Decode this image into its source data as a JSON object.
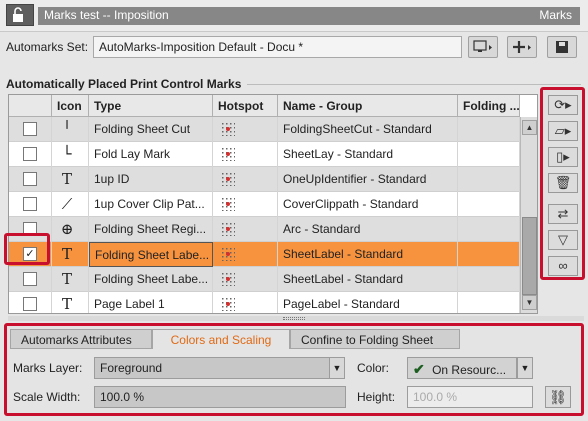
{
  "window": {
    "title": "Marks test -- Imposition",
    "panel_name": "Marks"
  },
  "automarks": {
    "label": "Automarks Set:",
    "value": "AutoMarks-Imposition Default - Docu *"
  },
  "section_title": "Automatically Placed Print Control Marks",
  "columns": [
    "Icon",
    "Type",
    "Hotspot",
    "Name - Group",
    "Folding ..."
  ],
  "rows": [
    {
      "checked": false,
      "icon": "folding-cut-icon",
      "icon_glyph": "╵",
      "type": "Folding Sheet Cut",
      "name_group": "FoldingSheetCut - Standard",
      "shaded": true
    },
    {
      "checked": false,
      "icon": "fold-lay-icon",
      "icon_glyph": "└",
      "type": "Fold Lay Mark",
      "name_group": "SheetLay - Standard",
      "shaded": false
    },
    {
      "checked": false,
      "icon": "text-icon",
      "icon_glyph": "T",
      "type": "1up ID",
      "name_group": "OneUpIdentifier - Standard",
      "shaded": true
    },
    {
      "checked": false,
      "icon": "magic-wand-icon",
      "icon_glyph": "⟋",
      "type": "1up Cover Clip Pat...",
      "name_group": "CoverClippath - Standard",
      "shaded": false
    },
    {
      "checked": false,
      "icon": "register-mark-icon",
      "icon_glyph": "⊕",
      "type": "Folding Sheet Regi...",
      "name_group": "Arc - Standard",
      "shaded": true
    },
    {
      "checked": true,
      "icon": "text-icon",
      "icon_glyph": "T",
      "type": "Folding Sheet Labe...",
      "name_group": "SheetLabel - Standard",
      "selected": true
    },
    {
      "checked": false,
      "icon": "text-icon",
      "icon_glyph": "T",
      "type": "Folding Sheet Labe...",
      "name_group": "SheetLabel - Standard",
      "shaded": true
    },
    {
      "checked": false,
      "icon": "text-icon",
      "icon_glyph": "T",
      "type": "Page Label 1",
      "name_group": "PageLabel - Standard",
      "shaded": false
    }
  ],
  "tabs": [
    "Automarks Attributes",
    "Colors and Scaling",
    "Confine to Folding Sheet"
  ],
  "active_tab": 1,
  "fields": {
    "marks_layer_label": "Marks Layer:",
    "marks_layer_value": "Foreground",
    "color_label": "Color:",
    "color_value": "On Resourc...",
    "scale_width_label": "Scale Width:",
    "scale_width_value": "100.0 %",
    "height_label": "Height:",
    "height_value": "100.0 %"
  },
  "colors": {
    "selected_row": "#f7933e",
    "highlight": "#c8102e",
    "active_tab_text": "#e06a15"
  }
}
